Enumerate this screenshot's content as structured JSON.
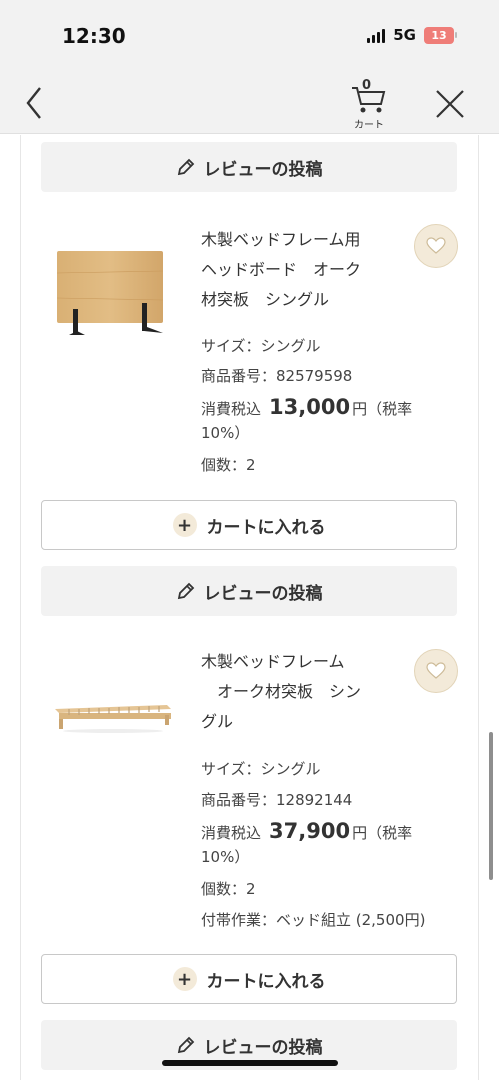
{
  "status": {
    "time": "12:30",
    "network": "5G",
    "battery": "13"
  },
  "nav": {
    "cart_count": "0",
    "cart_label": "カート"
  },
  "review_label": "レビューの投稿",
  "add_to_cart_label": "カートに入れる",
  "products": [
    {
      "title_lines": [
        "木製ベッドフレーム用",
        "ヘッドボード　オーク",
        "材突板　シングル"
      ],
      "size": "サイズ：シングル",
      "item_number": "商品番号：82579598",
      "price_label": "消費税込",
      "price": "13,000",
      "price_suffix": "円（税率",
      "tax_rate": "10%）",
      "quantity": "個数：2"
    },
    {
      "title_lines": [
        "木製ベッドフレーム",
        "　オーク材突板　シン",
        "グル"
      ],
      "size": "サイズ：シングル",
      "item_number": "商品番号：12892144",
      "price_label": "消費税込",
      "price": "37,900",
      "price_suffix": "円（税率",
      "tax_rate": "10%）",
      "quantity": "個数：2",
      "service": "付帯作業：ベッド組立 (2,500円)"
    }
  ]
}
